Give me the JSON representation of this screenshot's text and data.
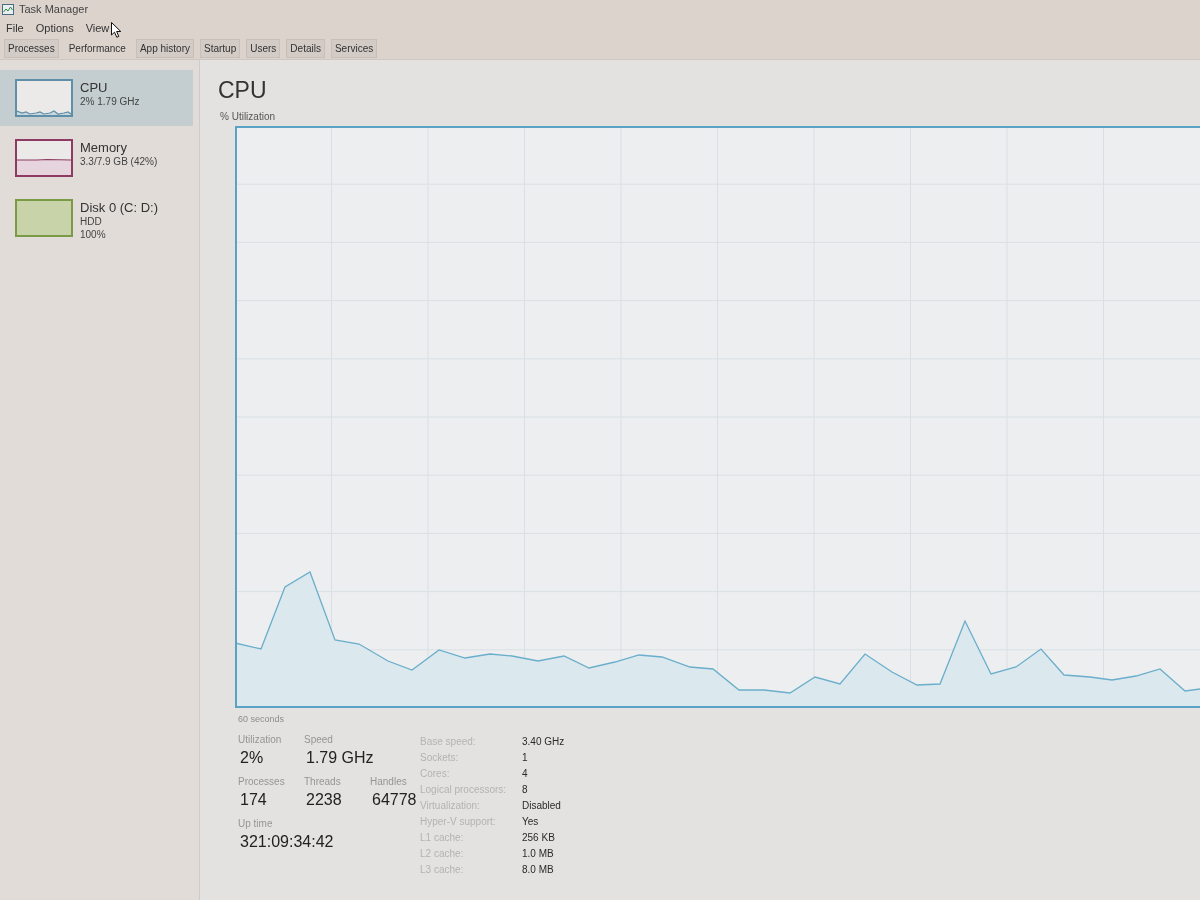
{
  "window": {
    "title": "Task Manager"
  },
  "menu": [
    "File",
    "Options",
    "View"
  ],
  "tabs": [
    {
      "label": "Processes",
      "selected": false
    },
    {
      "label": "Performance",
      "selected": true
    },
    {
      "label": "App history",
      "selected": false
    },
    {
      "label": "Startup",
      "selected": false
    },
    {
      "label": "Users",
      "selected": false
    },
    {
      "label": "Details",
      "selected": false
    },
    {
      "label": "Services",
      "selected": false
    }
  ],
  "sidebar": {
    "items": [
      {
        "kind": "cpu",
        "name": "CPU",
        "details": [
          "2% 1.79 GHz"
        ],
        "selected": true,
        "color": "#5f8fa8"
      },
      {
        "kind": "memory",
        "name": "Memory",
        "details": [
          "3.3/7.9 GB (42%)"
        ],
        "selected": false,
        "color": "#8e3b63"
      },
      {
        "kind": "disk",
        "name": "Disk 0 (C: D:)",
        "details": [
          "HDD",
          "100%"
        ],
        "selected": false,
        "color": "#7b9a46"
      }
    ]
  },
  "detail": {
    "title": "CPU",
    "graph_label": "% Utilization",
    "time_label": "60 seconds",
    "stat_rows": [
      {
        "stats": [
          {
            "label": "Utilization",
            "value": "2%"
          },
          {
            "label": "Speed",
            "value": "1.79 GHz"
          }
        ]
      },
      {
        "stats": [
          {
            "label": "Processes",
            "value": "174"
          },
          {
            "label": "Threads",
            "value": "2238"
          },
          {
            "label": "Handles",
            "value": "64778"
          }
        ]
      },
      {
        "stats": [
          {
            "label": "Up time",
            "value": "321:09:34:42"
          }
        ]
      }
    ],
    "specs": [
      {
        "label": "Base speed:",
        "value": "3.40 GHz"
      },
      {
        "label": "Sockets:",
        "value": "1"
      },
      {
        "label": "Cores:",
        "value": "4"
      },
      {
        "label": "Logical processors:",
        "value": "8"
      },
      {
        "label": "Virtualization:",
        "value": "Disabled"
      },
      {
        "label": "Hyper-V support:",
        "value": "Yes"
      },
      {
        "label": "L1 cache:",
        "value": "256 KB"
      },
      {
        "label": "L2 cache:",
        "value": "1.0 MB"
      },
      {
        "label": "L3 cache:",
        "value": "8.0 MB"
      }
    ]
  }
}
